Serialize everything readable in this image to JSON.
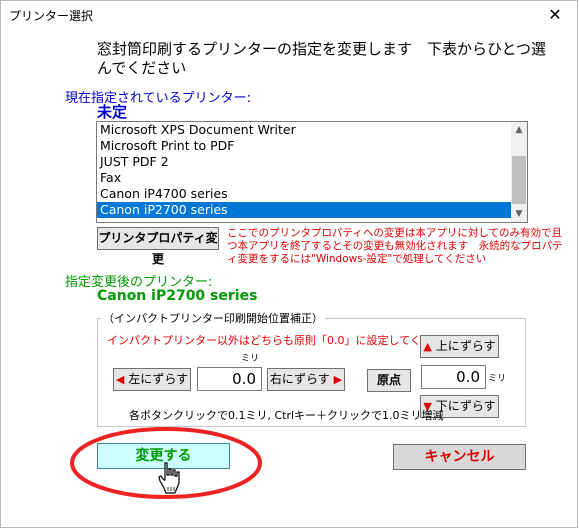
{
  "window": {
    "title": "プリンター選択",
    "close_glyph": "✕"
  },
  "instruction": "窓封筒印刷するプリンターの指定を変更します　下表からひとつ選んでください",
  "current": {
    "label": "現在指定されているプリンター:",
    "value": "未定"
  },
  "printer_list": {
    "items": [
      "Microsoft XPS Document Writer",
      "Microsoft Print to PDF",
      "JUST PDF 2",
      "Fax",
      "Canon iP4700 series",
      "Canon iP2700 series"
    ],
    "selected_index": 5
  },
  "properties": {
    "button_label": "プリンタプロパティ変更",
    "note": "ここでのプリンタプロパティへの変更は本アプリに対してのみ有効で且つ本アプリを終了するとその変更も無効化されます　永続的なプロパティ変更をするには\"Windows-設定\"で処理してください"
  },
  "after": {
    "label": "指定変更後のプリンター:",
    "value": "Canon iP2700 series"
  },
  "offset_group": {
    "title": "（インパクトプリンター印刷開始位置補正）",
    "note": "インパクトプリンター以外はどちらも原則「0.0」に設定してください",
    "left_button": "左にずらす",
    "right_button": "右にずらす",
    "origin_button": "原点",
    "up_button": "上にずらす",
    "down_button": "下にずらす",
    "horizontal_value": "0.0",
    "vertical_value": "0.0",
    "horizontal_unit": "ミリ",
    "vertical_unit": "ミリ",
    "hint": "各ボタンクリックで0.1ミリ,  Ctrlキー＋クリックで1.0ミリ増減"
  },
  "actions": {
    "confirm_label": "変更する",
    "cancel_label": "キャンセル"
  },
  "colors": {
    "blue_text": "#0000cc",
    "green_text": "#009900",
    "red_text": "#e00000",
    "selection": "#0078d7",
    "confirm_bg": "#ccffff",
    "ellipse": "#ee2222"
  }
}
